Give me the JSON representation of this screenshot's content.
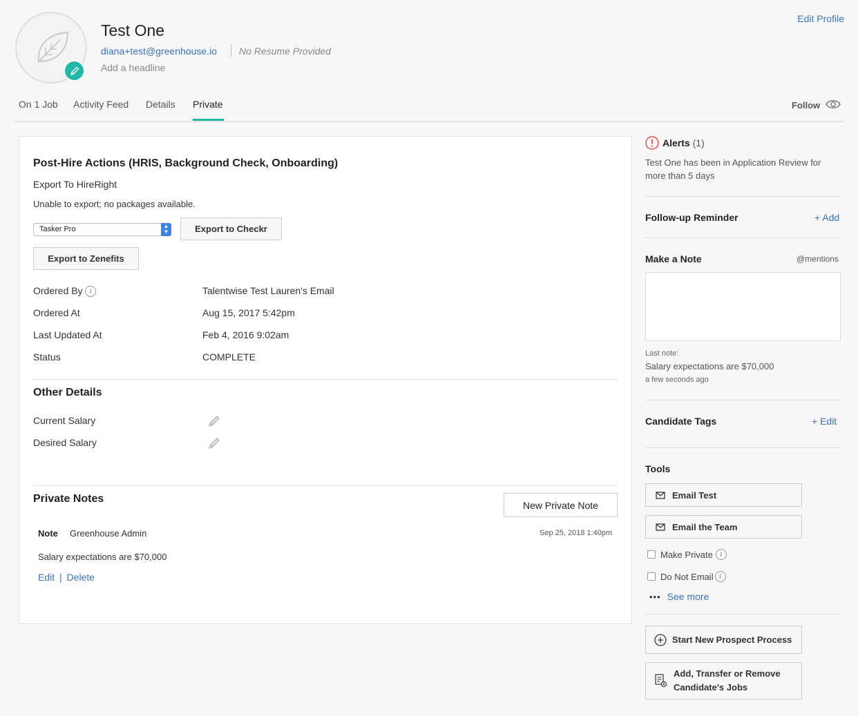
{
  "header": {
    "name": "Test One",
    "email": "diana+test@greenhouse.io",
    "resume_status": "No Resume Provided",
    "headline_placeholder": "Add a headline",
    "edit_profile": "Edit Profile"
  },
  "tabs": [
    {
      "label": "On 1 Job"
    },
    {
      "label": "Activity Feed"
    },
    {
      "label": "Details"
    },
    {
      "label": "Private",
      "active": true
    }
  ],
  "follow": {
    "label": "Follow",
    "icon": "eye-icon"
  },
  "post_hire": {
    "title": "Post-Hire Actions (HRIS, Background Check, Onboarding)",
    "export_hireright": "Export To HireRight",
    "unable_msg": "Unable to export; no packages available.",
    "package_select": "Tasker Pro",
    "export_checkr": "Export to Checkr",
    "export_zenefits": "Export to Zenefits",
    "fields": [
      {
        "label": "Ordered By",
        "value": "Talentwise Test Lauren's Email",
        "info": "i"
      },
      {
        "label": "Ordered At",
        "value": "Aug 15, 2017 5:42pm"
      },
      {
        "label": "Last Updated At",
        "value": "Feb 4, 2016 9:02am"
      },
      {
        "label": "Status",
        "value": "COMPLETE"
      }
    ]
  },
  "other_details": {
    "title": "Other Details",
    "current_salary": "Current Salary",
    "desired_salary": "Desired Salary"
  },
  "private_notes": {
    "title": "Private Notes",
    "new_button": "New Private Note",
    "note_label": "Note",
    "author": "Greenhouse Admin",
    "timestamp": "Sep 25, 2018 1:40pm",
    "body": "Salary expectations are $70,000",
    "edit": "Edit",
    "separator": "|",
    "delete": "Delete"
  },
  "sidebar": {
    "alerts_title": "Alerts",
    "alerts_count": "(1)",
    "alert_text": "Test One has been in Application Review for more than 5 days",
    "followup_title": "Follow-up Reminder",
    "followup_add": "+ Add",
    "note_title": "Make a Note",
    "mentions": "@mentions",
    "last_note_label": "Last note:",
    "last_note_text": "Salary expectations are $70,000",
    "last_note_time": "a few seconds ago",
    "tags_title": "Candidate Tags",
    "tags_edit": "+ Edit",
    "tools_title": "Tools",
    "email_test": "Email Test",
    "email_team": "Email the Team",
    "make_private": "Make Private",
    "do_not_email": "Do Not Email",
    "see_more_dots": "•••",
    "see_more": "See more",
    "start_prospect": "Start New Prospect Process",
    "transfer_jobs": "Add, Transfer or Remove Candidate's Jobs",
    "info_glyph": "i"
  },
  "colors": {
    "accent": "#1fb8a4",
    "link": "#3a74bd",
    "alert": "#d9534f"
  }
}
